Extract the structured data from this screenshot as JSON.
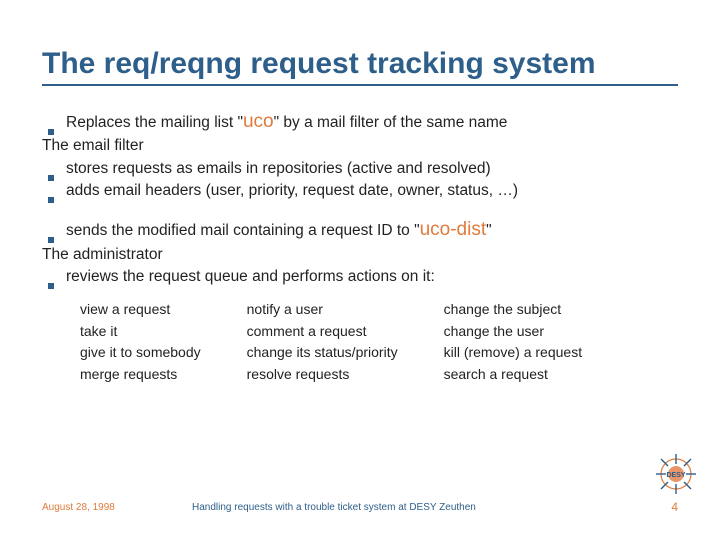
{
  "title": "The req/reqng request tracking system",
  "block1": {
    "line1_pre": "Replaces the mailing list \"",
    "line1_uco": "uco",
    "line1_post": "\" by a mail filter of the same name",
    "line2": "The email filter",
    "line3": "stores requests as emails in repositories (active and resolved)",
    "line4": "adds email headers (user, priority, request date, owner, status, …)"
  },
  "block2": {
    "line1_pre": "sends the modified mail containing a request ID to \"",
    "line1_uco": "uco-dist",
    "line1_post": "\"",
    "line2": "The administrator",
    "line3": "reviews the request queue and performs actions on it:"
  },
  "actions": {
    "col1": [
      "view a request",
      "take it",
      "give it to somebody",
      "merge requests"
    ],
    "col2": [
      "notify a user",
      "comment a request",
      "change its status/priority",
      "resolve requests"
    ],
    "col3": [
      "change the subject",
      "change the user",
      "kill (remove) a request",
      "search a request"
    ]
  },
  "footer": {
    "date": "August 28, 1998",
    "mid": "Handling requests with a trouble ticket system at DESY Zeuthen",
    "page": "4"
  },
  "logo_text": "DESY"
}
